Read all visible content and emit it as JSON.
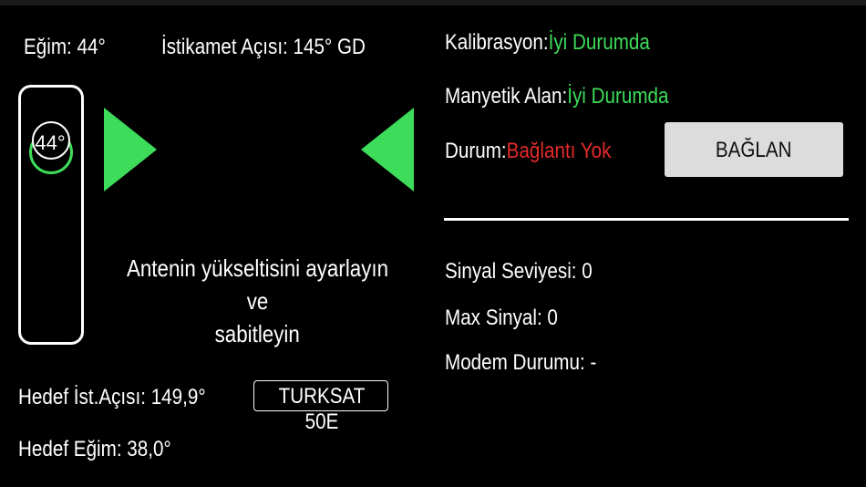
{
  "tilt": {
    "label": "Eğim:",
    "value": "44°"
  },
  "azimuth": {
    "label": "İstikamet Açısı:",
    "value": "145° GD"
  },
  "gauge": {
    "value": "44°"
  },
  "instruction": {
    "line1": "Antenin yükseltisini ayarlayın ve",
    "line2": "sabitleyin"
  },
  "target": {
    "azimuth_label": "Hedef İst.Açısı:",
    "azimuth_value": "149,9°",
    "tilt_label": "Hedef Eğim:",
    "tilt_value": "38,0°",
    "satellite": "TURKSAT 50E"
  },
  "status": {
    "calibration_label": "Kalibrasyon:",
    "calibration_value": "İyi Durumda",
    "magnetic_label": "Manyetik Alan:",
    "magnetic_value": "İyi Durumda",
    "connection_label": "Durum:",
    "connection_value": "Bağlantı Yok",
    "connect_button": "BAĞLAN"
  },
  "signal": {
    "level_label": "Sinyal Seviyesi:",
    "level_value": "0",
    "max_label": "Max Sinyal:",
    "max_value": "0",
    "modem_label": "Modem Durumu:",
    "modem_value": "-"
  },
  "colors": {
    "ok": "#3ddc5a",
    "error": "#e52b2b",
    "arrow": "#3ddc5a",
    "button_bg": "#dcdcdc"
  },
  "icons": {
    "left_indicator": "arrow-right-icon",
    "right_indicator": "arrow-left-icon"
  }
}
